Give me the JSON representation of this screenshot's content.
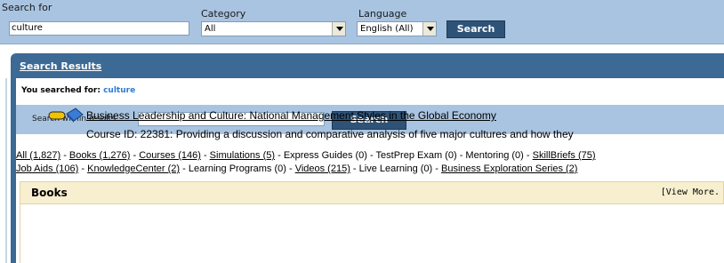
{
  "search": {
    "search_for_label": "Search for",
    "query": "culture",
    "category_label": "Category",
    "category_value": "All",
    "language_label": "Language",
    "language_value": "English (All)",
    "button": "Search"
  },
  "results": {
    "title": "Search Results",
    "you_searched_for": "You searched for:",
    "term": "culture",
    "within_label": "Search within results",
    "within_value": "",
    "within_button": "Search"
  },
  "filters": {
    "line1": [
      {
        "label": "All (1,827)",
        "link": true
      },
      {
        "label": "Books (1,276)",
        "link": true
      },
      {
        "label": "Courses (146)",
        "link": true
      },
      {
        "label": "Simulations (5)",
        "link": true
      },
      {
        "label": "Express Guides (0)",
        "link": false
      },
      {
        "label": "TestPrep Exam (0)",
        "link": false
      },
      {
        "label": "Mentoring (0)",
        "link": false
      },
      {
        "label": "SkillBriefs (75)",
        "link": true
      }
    ],
    "line2": [
      {
        "label": "Job Aids (106)",
        "link": true
      },
      {
        "label": "KnowledgeCenter (2)",
        "link": true
      },
      {
        "label": "Learning Programs (0)",
        "link": false
      },
      {
        "label": "Videos (215)",
        "link": true
      },
      {
        "label": "Live Learning (0)",
        "link": false
      },
      {
        "label": "Business Exploration Series (2)",
        "link": true
      }
    ]
  },
  "books": {
    "title": "Books",
    "view_more": "[View More.",
    "item_title": "Business Leadership and Culture: National Management Styles in the Global Economy",
    "item_desc": "Course ID: 22381: Providing a discussion and comparative analysis of five major cultures and how they"
  },
  "icons": {
    "item_icon": "book-icon"
  }
}
